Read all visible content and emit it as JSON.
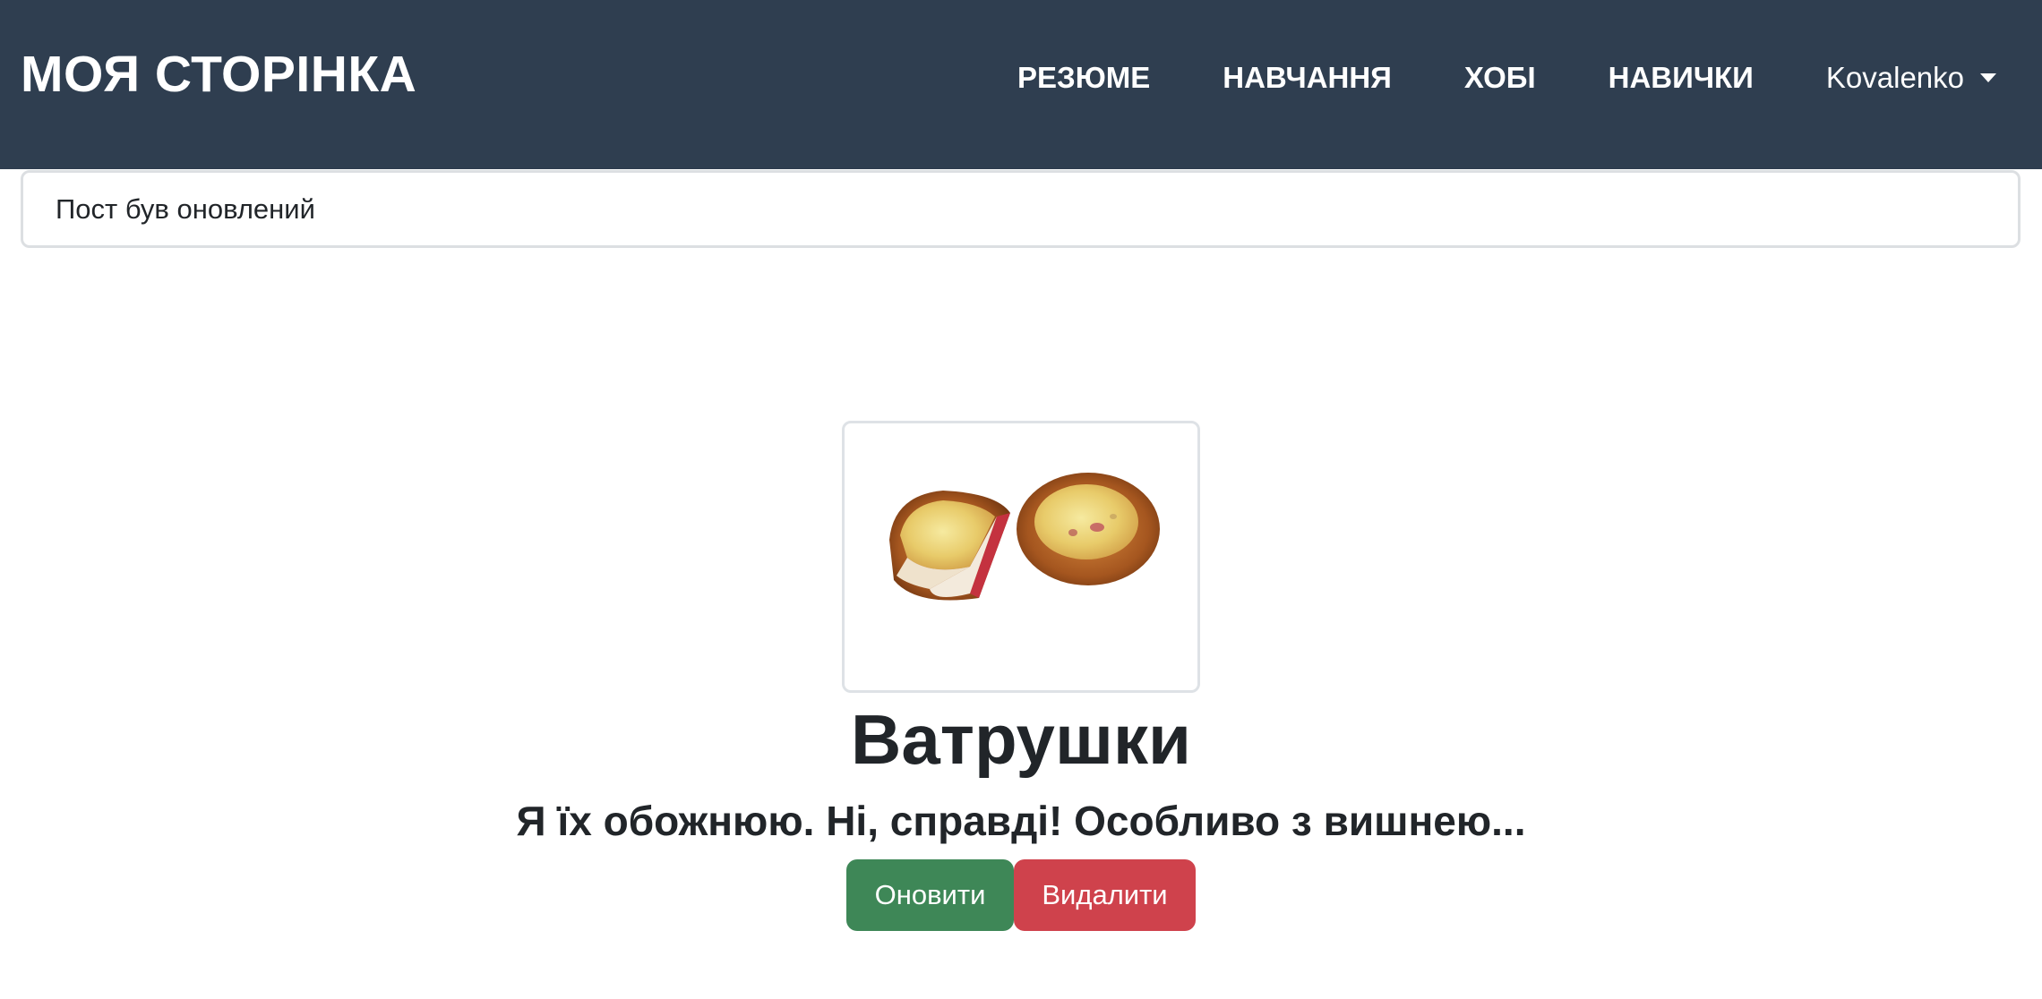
{
  "navbar": {
    "brand": "МОЯ СТОРІНКА",
    "links": [
      "РЕЗЮМЕ",
      "НАВЧАННЯ",
      "ХОБІ",
      "НАВИЧКИ"
    ],
    "user": "Kovalenko",
    "background": "#2f3e50"
  },
  "alert": {
    "message": "Пост був оновлений"
  },
  "post": {
    "image_icon": "vatrushka-pastry-photo",
    "title": "Ватрушки",
    "text": "Я їх обожнюю. Ні, справді! Особливо з вишнею...",
    "update_label": "Оновити",
    "delete_label": "Видалити",
    "update_color": "#3e8757",
    "delete_color": "#cf424c"
  }
}
